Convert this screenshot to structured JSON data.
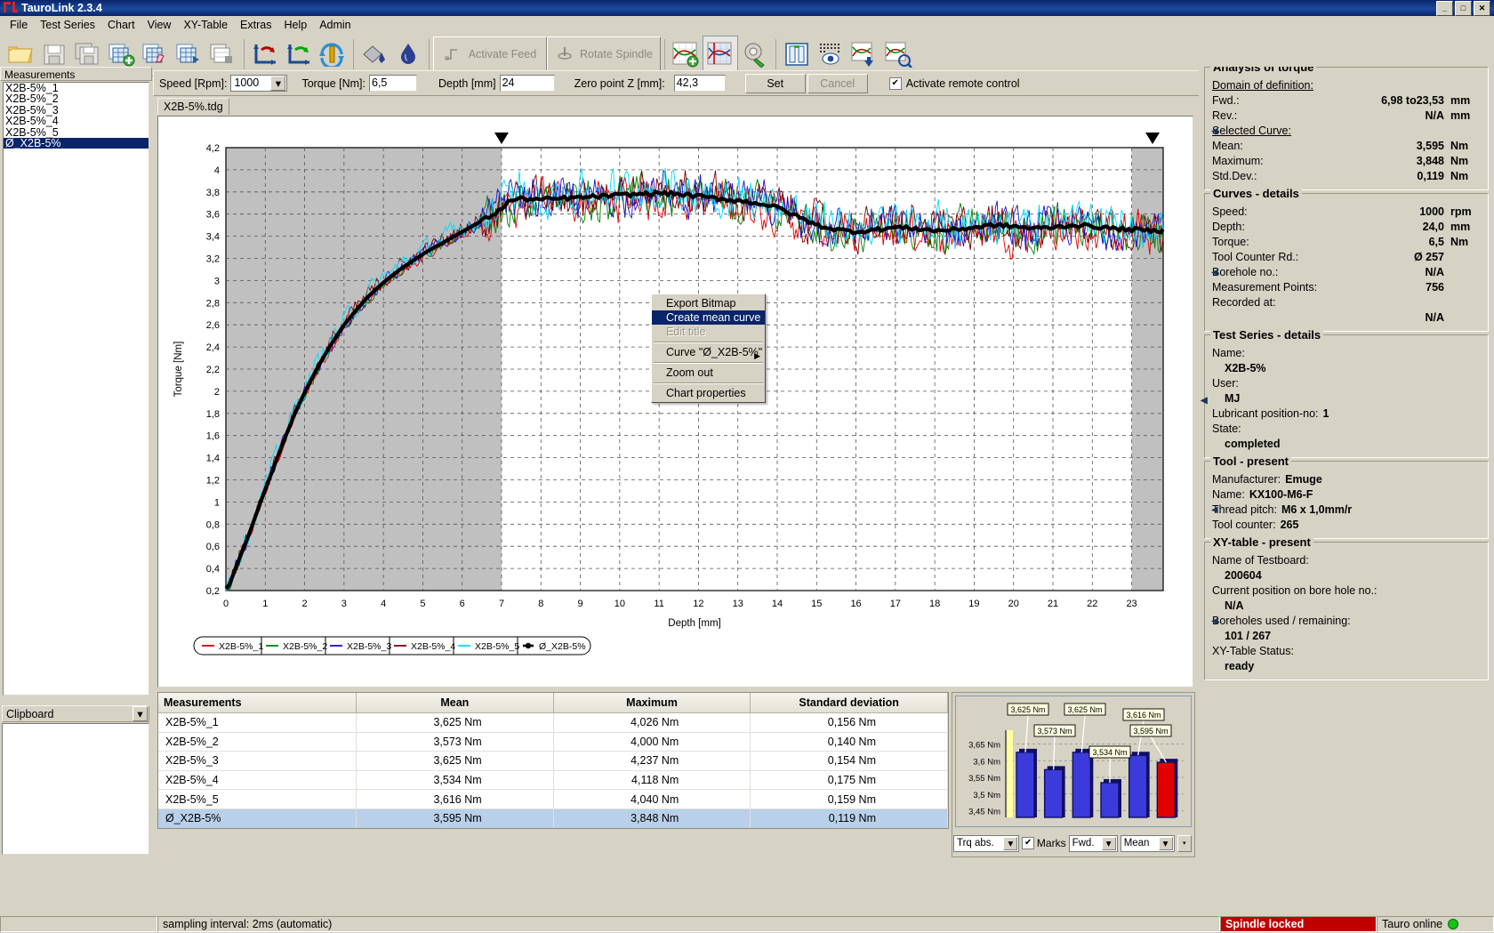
{
  "window": {
    "title": "TauroLink 2.3.4",
    "buttons": {
      "minimize": "_",
      "maximize": "□",
      "close": "✕"
    }
  },
  "menubar": [
    {
      "label": "File"
    },
    {
      "label": "Test Series"
    },
    {
      "label": "Chart"
    },
    {
      "label": "View"
    },
    {
      "label": "XY-Table"
    },
    {
      "label": "Extras"
    },
    {
      "label": "Help"
    },
    {
      "label": "Admin"
    }
  ],
  "toolbar": {
    "icons": [
      "open-folder-icon",
      "save-disk-icon",
      "save-all-icon",
      "add-table-icon",
      "edit-table-icon",
      "export-table-icon",
      "copy-table-icon",
      "undo-axis-icon",
      "redo-axis-icon",
      "refresh-spindle-icon",
      "paint-bucket-icon",
      "coolant-drop-icon"
    ],
    "activate_feed": "Activate Feed",
    "rotate_spindle": "Rotate Spindle",
    "right_icons": [
      "add-chart-icon",
      "chart-select-icon",
      "chart-settings-icon",
      "panel-view-icon",
      "matrix-view-icon",
      "export-chart-icon",
      "analyze-chart-icon"
    ]
  },
  "params": {
    "speed_label": "Speed [Rpm]:",
    "speed_value": "1000",
    "torque_label": "Torque [Nm]:",
    "torque_value": "6,5",
    "depth_label": "Depth [mm]",
    "depth_value": "24",
    "zero_label": "Zero point Z [mm]:",
    "zero_value": "42,3",
    "set_button": "Set",
    "cancel_button": "Cancel",
    "remote_checkbox_label": "Activate remote control",
    "remote_checked": "✔"
  },
  "left_panel": {
    "header": "Measurements",
    "items": [
      {
        "label": "X2B-5%_1",
        "selected": false
      },
      {
        "label": "X2B-5%_2",
        "selected": false
      },
      {
        "label": "X2B-5%_3",
        "selected": false
      },
      {
        "label": "X2B-5%_4",
        "selected": false
      },
      {
        "label": "X2B-5%_5",
        "selected": false
      },
      {
        "label": "Ø_X2B-5%",
        "selected": true
      }
    ],
    "clipboard_label": "Clipboard"
  },
  "tabs": [
    {
      "label": "X2B-5%.tdg",
      "active": true
    }
  ],
  "context_menu": {
    "items": [
      {
        "label": "Export Bitmap",
        "state": "normal"
      },
      {
        "label": "Create mean curve",
        "state": "highlighted"
      },
      {
        "label": "Edit title",
        "state": "disabled"
      },
      {
        "separator": true
      },
      {
        "label": "Curve \"Ø_X2B-5%\"",
        "state": "normal",
        "submenu": true
      },
      {
        "separator": true
      },
      {
        "label": "Zoom out",
        "state": "normal"
      },
      {
        "separator": true
      },
      {
        "label": "Chart properties",
        "state": "normal"
      }
    ]
  },
  "chart_data": {
    "type": "line",
    "title": "",
    "xlabel": "Depth [mm]",
    "ylabel": "Torque [Nm]",
    "xlim": [
      0,
      23.8
    ],
    "ylim": [
      0.2,
      4.2
    ],
    "xticks": [
      "0",
      "1",
      "2",
      "3",
      "4",
      "5",
      "6",
      "7",
      "8",
      "9",
      "10",
      "11",
      "12",
      "13",
      "14",
      "15",
      "16",
      "17",
      "18",
      "19",
      "20",
      "21",
      "22",
      "23"
    ],
    "yticks": [
      "0,2",
      "0,4",
      "0,6",
      "0,8",
      "1",
      "1,2",
      "1,4",
      "1,6",
      "1,8",
      "2",
      "2,2",
      "2,4",
      "2,6",
      "2,8",
      "3",
      "3,2",
      "3,4",
      "3,6",
      "3,8",
      "4",
      "4,2"
    ],
    "grid": true,
    "legend_position": "bottom",
    "shaded_regions": [
      {
        "from": 0,
        "to": 7.0,
        "color": "#c0c0c0"
      },
      {
        "from": 23.0,
        "to": 23.8,
        "color": "#c0c0c0"
      }
    ],
    "markers": [
      {
        "x": 7.0,
        "type": "domain-start-marker"
      },
      {
        "x": 23.53,
        "type": "domain-end-marker"
      }
    ],
    "series": [
      {
        "name": "X2B-5%_1",
        "color": "#e00000"
      },
      {
        "name": "X2B-5%_2",
        "color": "#008000"
      },
      {
        "name": "X2B-5%_3",
        "color": "#1414d2"
      },
      {
        "name": "X2B-5%_4",
        "color": "#800000"
      },
      {
        "name": "X2B-5%_5",
        "color": "#00dcff"
      },
      {
        "name": "Ø_X2B-5%",
        "color": "#000000"
      }
    ],
    "mean_profile_x": [
      0.05,
      0.3,
      0.6,
      0.9,
      1.2,
      1.5,
      1.8,
      2.1,
      2.4,
      2.7,
      3.0,
      3.3,
      3.6,
      3.9,
      4.2,
      4.5,
      4.8,
      5.1,
      5.4,
      5.7,
      6.0,
      6.3,
      6.6,
      6.9,
      7.2,
      7.5,
      8.0,
      8.5,
      9.0,
      9.5,
      10.0,
      10.5,
      11.0,
      11.5,
      12.0,
      12.5,
      13.0,
      13.5,
      14.0,
      14.5,
      15.0,
      15.5,
      16.0,
      16.5,
      17.0,
      17.5,
      18.0,
      18.5,
      19.0,
      19.5,
      20.0,
      20.5,
      21.0,
      21.5,
      22.0,
      22.5,
      23.0,
      23.5
    ],
    "mean_profile_y": [
      0.22,
      0.45,
      0.72,
      1.02,
      1.3,
      1.58,
      1.84,
      2.06,
      2.26,
      2.44,
      2.6,
      2.73,
      2.85,
      2.95,
      3.04,
      3.12,
      3.19,
      3.26,
      3.32,
      3.38,
      3.44,
      3.5,
      3.56,
      3.62,
      3.72,
      3.74,
      3.73,
      3.74,
      3.75,
      3.76,
      3.77,
      3.78,
      3.79,
      3.78,
      3.76,
      3.74,
      3.72,
      3.7,
      3.66,
      3.58,
      3.5,
      3.46,
      3.44,
      3.46,
      3.48,
      3.47,
      3.45,
      3.46,
      3.48,
      3.5,
      3.49,
      3.47,
      3.48,
      3.5,
      3.49,
      3.47,
      3.46,
      3.45
    ]
  },
  "legend": [
    {
      "label": "X2B-5%_1",
      "color": "#e00000"
    },
    {
      "label": "X2B-5%_2",
      "color": "#008000"
    },
    {
      "label": "X2B-5%_3",
      "color": "#1414d2"
    },
    {
      "label": "X2B-5%_4",
      "color": "#800000"
    },
    {
      "label": "X2B-5%_5",
      "color": "#00dcff"
    },
    {
      "label": "Ø_X2B-5%",
      "color": "#000000"
    }
  ],
  "table": {
    "headers": [
      "Measurements",
      "Mean",
      "Maximum",
      "Standard deviation"
    ],
    "rows": [
      {
        "name": "X2B-5%_1",
        "mean": "3,625 Nm",
        "max": "4,026 Nm",
        "sd": "0,156 Nm",
        "selected": false
      },
      {
        "name": "X2B-5%_2",
        "mean": "3,573 Nm",
        "max": "4,000 Nm",
        "sd": "0,140 Nm",
        "selected": false
      },
      {
        "name": "X2B-5%_3",
        "mean": "3,625 Nm",
        "max": "4,237 Nm",
        "sd": "0,154 Nm",
        "selected": false
      },
      {
        "name": "X2B-5%_4",
        "mean": "3,534 Nm",
        "max": "4,118 Nm",
        "sd": "0,175 Nm",
        "selected": false
      },
      {
        "name": "X2B-5%_5",
        "mean": "3,616 Nm",
        "max": "4,040 Nm",
        "sd": "0,159 Nm",
        "selected": false
      },
      {
        "name": "Ø_X2B-5%",
        "mean": "3,595 Nm",
        "max": "3,848 Nm",
        "sd": "0,119 Nm",
        "selected": true
      }
    ]
  },
  "mini_chart": {
    "type": "bar",
    "categories": [
      "X2B-5%_1",
      "X2B-5%_2",
      "X2B-5%_3",
      "X2B-5%_4",
      "X2B-5%_5",
      "Ø_X2B-5%"
    ],
    "values": [
      3.625,
      3.573,
      3.625,
      3.534,
      3.616,
      3.595
    ],
    "labels": [
      "3,625 Nm",
      "3,573 Nm",
      "3,625 Nm",
      "3,534 Nm",
      "3,616 Nm",
      "3,595 Nm"
    ],
    "bar_colors": [
      "#3b3bdc",
      "#3b3bdc",
      "#3b3bdc",
      "#3b3bdc",
      "#3b3bdc",
      "#e00000"
    ],
    "yticks": [
      "3,65 Nm",
      "3,6 Nm",
      "3,55 Nm",
      "3,5 Nm",
      "3,45 Nm"
    ],
    "ylim": [
      3.43,
      3.67
    ],
    "ylabel": "",
    "xlabel": "",
    "grid": true,
    "extra_label": "3,616 Nm"
  },
  "mini_controls": {
    "unit_select": "Trq abs.",
    "marks_label": "Marks",
    "marks_checked": "✔",
    "direction_select": "Fwd.",
    "stat_select": "Mean",
    "scroll_icon": "chevron-down-icon"
  },
  "right_panel": {
    "analysis": {
      "title": "Analysis of torque",
      "domain_label": "Domain of definition:",
      "fwd_label": "Fwd.:",
      "fwd_value": "6,98 to23,53",
      "fwd_unit": "mm",
      "rev_label": "Rev.:",
      "rev_value": "N/A",
      "rev_unit": "mm",
      "selected_label": "Selected Curve:",
      "mean_label": "Mean:",
      "mean_value": "3,595",
      "mean_unit": "Nm",
      "max_label": "Maximum:",
      "max_value": "3,848",
      "max_unit": "Nm",
      "sd_label": "Std.Dev.:",
      "sd_value": "0,119",
      "sd_unit": "Nm"
    },
    "curves": {
      "title": "Curves - details",
      "speed_label": "Speed:",
      "speed_value": "1000",
      "speed_unit": "rpm",
      "depth_label": "Depth:",
      "depth_value": "24,0",
      "depth_unit": "mm",
      "torque_label": "Torque:",
      "torque_value": "6,5",
      "torque_unit": "Nm",
      "tool_counter_label": "Tool Counter Rd.:",
      "tool_counter_value": "Ø 257",
      "borehole_label": "Borehole no.:",
      "borehole_value": "N/A",
      "points_label": "Measurement Points:",
      "points_value": "756",
      "recorded_label": "Recorded at:",
      "recorded_value": "N/A"
    },
    "test_series": {
      "title": "Test Series - details",
      "name_label": "Name:",
      "name_value": "X2B-5%",
      "user_label": "User:",
      "user_value": "MJ",
      "lubricant_label": "Lubricant position-no:",
      "lubricant_value": "1",
      "state_label": "State:",
      "state_value": "completed"
    },
    "tool": {
      "title": "Tool - present",
      "manufacturer_label": "Manufacturer:",
      "manufacturer_value": "Emuge",
      "name_label": "Name:",
      "name_value": "KX100-M6-F",
      "pitch_label": "Thread pitch:",
      "pitch_value": "M6 x  1,0mm/r",
      "counter_label": "Tool counter:",
      "counter_value": "265"
    },
    "xytable": {
      "title": "XY-table - present",
      "testboard_label": "Name of Testboard:",
      "testboard_value": "200604",
      "position_label": "Current position on bore hole no.:",
      "position_value": "N/A",
      "boreholes_label": "Boreholes used / remaining:",
      "boreholes_value": "101 / 267",
      "status_label": "XY-Table Status:",
      "status_value": "ready"
    }
  },
  "status": {
    "sampling": "sampling interval: 2ms (automatic)",
    "spindle": "Spindle locked",
    "connection": "Tauro online"
  }
}
